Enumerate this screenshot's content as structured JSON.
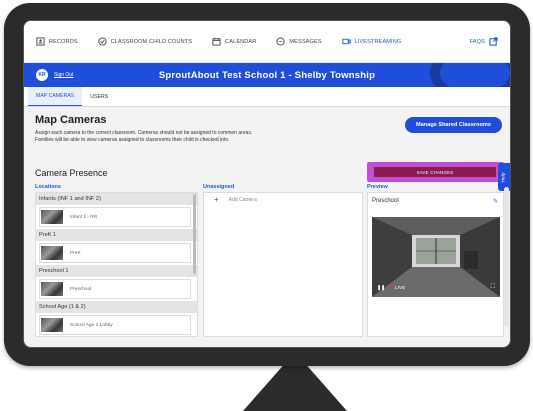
{
  "nav": {
    "items": [
      {
        "label": "RECORDS",
        "icon": "records-icon"
      },
      {
        "label": "CLASSROOM CHILD COUNTS",
        "icon": "check-circle-icon"
      },
      {
        "label": "CALENDAR",
        "icon": "calendar-icon"
      },
      {
        "label": "MESSAGES",
        "icon": "message-icon"
      },
      {
        "label": "LIVESTREAMING",
        "icon": "video-camera-icon"
      }
    ],
    "faqs": "FAQS"
  },
  "banner": {
    "initials": "KR",
    "sign_out": "Sign Out",
    "school": "SproutAbout Test School 1 - Shelby Township"
  },
  "tabs": [
    "MAP CAMERAS",
    "USERS"
  ],
  "page": {
    "title": "Map Cameras",
    "desc_line1": "Assign each camera to the correct classroom. Cameras should not be assigned to common areas.",
    "desc_line2": "Families will be able to view cameras assigned to classrooms their child is checked into.",
    "manage_button": "Manage Shared Classrooms",
    "save_button": "SAVE CHANGES",
    "help": "Help"
  },
  "camera_presence": {
    "title": "Camera Presence",
    "locations_label": "Locations",
    "unassigned_label": "Unassigned",
    "preview_label": "Preview",
    "groups": [
      {
        "name": "Infants (INF 1 and INF 2)",
        "camera": "Infant 1 - RR"
      },
      {
        "name": "PreK 1",
        "camera": "PreK"
      },
      {
        "name": "Preschool 1",
        "camera": "Preschool"
      },
      {
        "name": "School Age (1 & 2)",
        "camera": "School Age 1 Lobby"
      }
    ],
    "add_camera": "Add Camera",
    "preview_name": "Preschool",
    "live": "LIVE"
  },
  "colors": {
    "brand_blue": "#1f4fd8",
    "highlight": "#c34fd6",
    "save_button": "#8b1a4f"
  }
}
